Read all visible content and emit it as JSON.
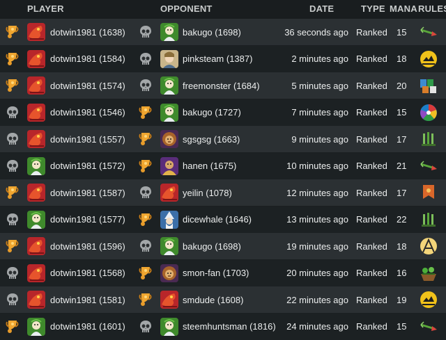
{
  "headers": {
    "player": "PLAYER",
    "opponent": "OPPONENT",
    "date": "DATE",
    "type": "TYPE",
    "mana": "MANA",
    "rules": "RULES"
  },
  "colors": {
    "row_odd": "#2b3033",
    "row_even": "#1c2123",
    "trophy": "#e79b2a",
    "skull": "#9ea2a4"
  },
  "rows": [
    {
      "player_result": "trophy-icon",
      "player": "dotwin1981 (1638)",
      "player_avatar": "red-dragon-avatar",
      "opp_result": "skull-icon",
      "opponent": "bakugo (1698)",
      "opp_avatar": "green-mage-avatar",
      "date": "36 seconds ago",
      "type": "Ranked",
      "mana": "15",
      "rule": "broken-arrows-rule-icon"
    },
    {
      "player_result": "trophy-icon",
      "player": "dotwin1981 (1584)",
      "player_avatar": "red-dragon-avatar",
      "opp_result": "skull-icon",
      "opponent": "pinksteam (1387)",
      "opp_avatar": "elf-avatar",
      "date": "2 minutes ago",
      "type": "Ranked",
      "mana": "18",
      "rule": "earthquake-rule-icon"
    },
    {
      "player_result": "trophy-icon",
      "player": "dotwin1981 (1574)",
      "player_avatar": "red-dragon-avatar",
      "opp_result": "skull-icon",
      "opponent": "freemonster (1684)",
      "opp_avatar": "green-mage-avatar",
      "date": "5 minutes ago",
      "type": "Ranked",
      "mana": "20",
      "rule": "keep-your-distance-rule-icon"
    },
    {
      "player_result": "skull-icon",
      "player": "dotwin1981 (1546)",
      "player_avatar": "red-dragon-avatar",
      "opp_result": "trophy-icon",
      "opponent": "bakugo (1727)",
      "opp_avatar": "green-mage-avatar",
      "date": "7 minutes ago",
      "type": "Ranked",
      "mana": "15",
      "rule": "random-colors-rule-icon"
    },
    {
      "player_result": "skull-icon",
      "player": "dotwin1981 (1557)",
      "player_avatar": "red-dragon-avatar",
      "opp_result": "trophy-icon",
      "opponent": "sgsgsg (1663)",
      "opp_avatar": "lion-avatar",
      "date": "9 minutes ago",
      "type": "Ranked",
      "mana": "17",
      "rule": "standard-rule-icon"
    },
    {
      "player_result": "skull-icon",
      "player": "dotwin1981 (1572)",
      "player_avatar": "green-mage-avatar",
      "opp_result": "trophy-icon",
      "opponent": "hanen (1675)",
      "opp_avatar": "purple-monk-avatar",
      "date": "10 minutes ago",
      "type": "Ranked",
      "mana": "21",
      "rule": "broken-arrows-rule-icon"
    },
    {
      "player_result": "trophy-icon",
      "player": "dotwin1981 (1587)",
      "player_avatar": "red-dragon-avatar",
      "opp_result": "skull-icon",
      "opponent": "yeilin (1078)",
      "opp_avatar": "red-dragon-avatar",
      "date": "12 minutes ago",
      "type": "Ranked",
      "mana": "17",
      "rule": "banner-rule-icon"
    },
    {
      "player_result": "skull-icon",
      "player": "dotwin1981 (1577)",
      "player_avatar": "green-mage-avatar",
      "opp_result": "trophy-icon",
      "opponent": "dicewhale (1646)",
      "opp_avatar": "wizard-avatar",
      "date": "13 minutes ago",
      "type": "Ranked",
      "mana": "22",
      "rule": "standard-rule-icon"
    },
    {
      "player_result": "trophy-icon",
      "player": "dotwin1981 (1596)",
      "player_avatar": "red-dragon-avatar",
      "opp_result": "skull-icon",
      "opponent": "bakugo (1698)",
      "opp_avatar": "green-mage-avatar",
      "date": "19 minutes ago",
      "type": "Ranked",
      "mana": "18",
      "rule": "aim-true-rule-icon"
    },
    {
      "player_result": "skull-icon",
      "player": "dotwin1981 (1568)",
      "player_avatar": "red-dragon-avatar",
      "opp_result": "trophy-icon",
      "opponent": "smon-fan (1703)",
      "opp_avatar": "lion-avatar",
      "date": "20 minutes ago",
      "type": "Ranked",
      "mana": "16",
      "rule": "spreading-fury-rule-icon"
    },
    {
      "player_result": "skull-icon",
      "player": "dotwin1981 (1581)",
      "player_avatar": "red-dragon-avatar",
      "opp_result": "trophy-icon",
      "opponent": "smdude (1608)",
      "opp_avatar": "red-dragon-avatar",
      "date": "22 minutes ago",
      "type": "Ranked",
      "mana": "19",
      "rule": "earthquake-rule-icon"
    },
    {
      "player_result": "trophy-icon",
      "player": "dotwin1981 (1601)",
      "player_avatar": "green-mage-avatar",
      "opp_result": "skull-icon",
      "opponent": "steemhuntsman (1816)",
      "opp_avatar": "green-mage-avatar",
      "date": "24 minutes ago",
      "type": "Ranked",
      "mana": "15",
      "rule": "broken-arrows-rule-icon"
    }
  ]
}
